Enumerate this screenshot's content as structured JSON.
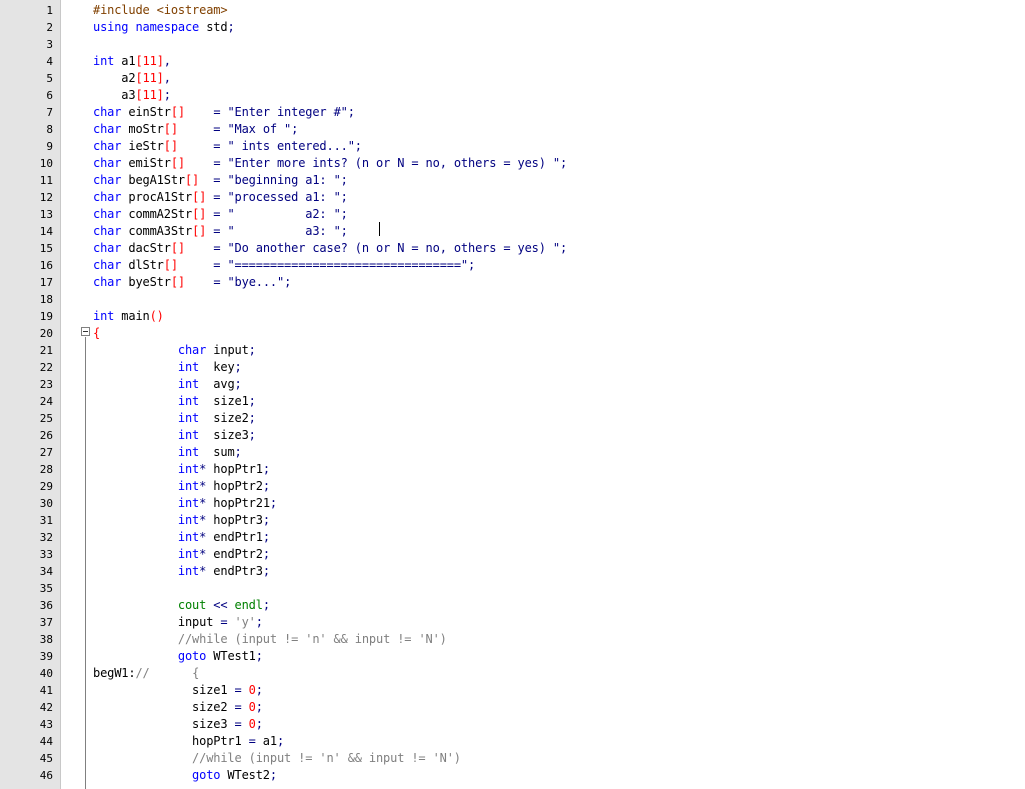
{
  "editor": {
    "lines": [
      {
        "n": "1",
        "tokens": [
          [
            "pp",
            "#include "
          ],
          [
            "pp",
            "<iostream>"
          ]
        ]
      },
      {
        "n": "2",
        "tokens": [
          [
            "kw",
            "using namespace"
          ],
          [
            "id",
            " std"
          ],
          [
            "op",
            ";"
          ]
        ]
      },
      {
        "n": "3",
        "tokens": []
      },
      {
        "n": "4",
        "tokens": [
          [
            "ty",
            "int"
          ],
          [
            "id",
            " a1"
          ],
          [
            "br",
            "[11]"
          ],
          [
            "op",
            ","
          ]
        ]
      },
      {
        "n": "5",
        "tokens": [
          [
            "id",
            "    a2"
          ],
          [
            "br",
            "[11]"
          ],
          [
            "op",
            ","
          ]
        ]
      },
      {
        "n": "6",
        "tokens": [
          [
            "id",
            "    a3"
          ],
          [
            "br",
            "[11]"
          ],
          [
            "op",
            ";"
          ]
        ]
      },
      {
        "n": "7",
        "tokens": [
          [
            "ty",
            "char"
          ],
          [
            "id",
            " einStr"
          ],
          [
            "br",
            "[]"
          ],
          [
            "id",
            "    "
          ],
          [
            "op",
            "="
          ],
          [
            "strb",
            " \"Enter integer #\""
          ],
          [
            "op",
            ";"
          ]
        ]
      },
      {
        "n": "8",
        "tokens": [
          [
            "ty",
            "char"
          ],
          [
            "id",
            " moStr"
          ],
          [
            "br",
            "[]"
          ],
          [
            "id",
            "     "
          ],
          [
            "op",
            "="
          ],
          [
            "strb",
            " \"Max of \""
          ],
          [
            "op",
            ";"
          ]
        ]
      },
      {
        "n": "9",
        "tokens": [
          [
            "ty",
            "char"
          ],
          [
            "id",
            " ieStr"
          ],
          [
            "br",
            "[]"
          ],
          [
            "id",
            "     "
          ],
          [
            "op",
            "="
          ],
          [
            "strb",
            " \" ints entered...\""
          ],
          [
            "op",
            ";"
          ]
        ]
      },
      {
        "n": "10",
        "tokens": [
          [
            "ty",
            "char"
          ],
          [
            "id",
            " emiStr"
          ],
          [
            "br",
            "[]"
          ],
          [
            "id",
            "    "
          ],
          [
            "op",
            "="
          ],
          [
            "strb",
            " \"Enter more ints? (n or N = no, others = yes) \""
          ],
          [
            "op",
            ";"
          ]
        ]
      },
      {
        "n": "11",
        "tokens": [
          [
            "ty",
            "char"
          ],
          [
            "id",
            " begA1Str"
          ],
          [
            "br",
            "[]"
          ],
          [
            "id",
            "  "
          ],
          [
            "op",
            "="
          ],
          [
            "strb",
            " \"beginning a1: \""
          ],
          [
            "op",
            ";"
          ]
        ]
      },
      {
        "n": "12",
        "tokens": [
          [
            "ty",
            "char"
          ],
          [
            "id",
            " procA1Str"
          ],
          [
            "br",
            "[]"
          ],
          [
            "id",
            " "
          ],
          [
            "op",
            "="
          ],
          [
            "strb",
            " \"processed a1: \""
          ],
          [
            "op",
            ";"
          ]
        ]
      },
      {
        "n": "13",
        "tokens": [
          [
            "ty",
            "char"
          ],
          [
            "id",
            " commA2Str"
          ],
          [
            "br",
            "[]"
          ],
          [
            "id",
            " "
          ],
          [
            "op",
            "="
          ],
          [
            "strb",
            " \"          a2: \""
          ],
          [
            "op",
            ";"
          ]
        ]
      },
      {
        "n": "14",
        "tokens": [
          [
            "ty",
            "char"
          ],
          [
            "id",
            " commA3Str"
          ],
          [
            "br",
            "[]"
          ],
          [
            "id",
            " "
          ],
          [
            "op",
            "="
          ],
          [
            "strb",
            " \"          a3: \""
          ],
          [
            "op",
            ";"
          ]
        ]
      },
      {
        "n": "15",
        "tokens": [
          [
            "ty",
            "char"
          ],
          [
            "id",
            " dacStr"
          ],
          [
            "br",
            "[]"
          ],
          [
            "id",
            "    "
          ],
          [
            "op",
            "="
          ],
          [
            "strb",
            " \"Do another case? (n or N = no, others = yes) \""
          ],
          [
            "op",
            ";"
          ]
        ]
      },
      {
        "n": "16",
        "tokens": [
          [
            "ty",
            "char"
          ],
          [
            "id",
            " dlStr"
          ],
          [
            "br",
            "[]"
          ],
          [
            "id",
            "     "
          ],
          [
            "op",
            "="
          ],
          [
            "strb",
            " \"================================\""
          ],
          [
            "op",
            ";"
          ]
        ]
      },
      {
        "n": "17",
        "tokens": [
          [
            "ty",
            "char"
          ],
          [
            "id",
            " byeStr"
          ],
          [
            "br",
            "[]"
          ],
          [
            "id",
            "    "
          ],
          [
            "op",
            "="
          ],
          [
            "strb",
            " \"bye...\""
          ],
          [
            "op",
            ";"
          ]
        ]
      },
      {
        "n": "18",
        "tokens": []
      },
      {
        "n": "19",
        "tokens": [
          [
            "ty",
            "int"
          ],
          [
            "id",
            " main"
          ],
          [
            "br",
            "()"
          ]
        ]
      },
      {
        "n": "20",
        "tokens": [
          [
            "br",
            "{"
          ]
        ]
      },
      {
        "n": "21",
        "tokens": [
          [
            "id",
            "            "
          ],
          [
            "ty",
            "char"
          ],
          [
            "id",
            " input"
          ],
          [
            "op",
            ";"
          ]
        ]
      },
      {
        "n": "22",
        "tokens": [
          [
            "id",
            "            "
          ],
          [
            "ty",
            "int"
          ],
          [
            "id",
            "  key"
          ],
          [
            "op",
            ";"
          ]
        ]
      },
      {
        "n": "23",
        "tokens": [
          [
            "id",
            "            "
          ],
          [
            "ty",
            "int"
          ],
          [
            "id",
            "  avg"
          ],
          [
            "op",
            ";"
          ]
        ]
      },
      {
        "n": "24",
        "tokens": [
          [
            "id",
            "            "
          ],
          [
            "ty",
            "int"
          ],
          [
            "id",
            "  size1"
          ],
          [
            "op",
            ";"
          ]
        ]
      },
      {
        "n": "25",
        "tokens": [
          [
            "id",
            "            "
          ],
          [
            "ty",
            "int"
          ],
          [
            "id",
            "  size2"
          ],
          [
            "op",
            ";"
          ]
        ]
      },
      {
        "n": "26",
        "tokens": [
          [
            "id",
            "            "
          ],
          [
            "ty",
            "int"
          ],
          [
            "id",
            "  size3"
          ],
          [
            "op",
            ";"
          ]
        ]
      },
      {
        "n": "27",
        "tokens": [
          [
            "id",
            "            "
          ],
          [
            "ty",
            "int"
          ],
          [
            "id",
            "  sum"
          ],
          [
            "op",
            ";"
          ]
        ]
      },
      {
        "n": "28",
        "tokens": [
          [
            "id",
            "            "
          ],
          [
            "ty",
            "int"
          ],
          [
            "op",
            "*"
          ],
          [
            "id",
            " hopPtr1"
          ],
          [
            "op",
            ";"
          ]
        ]
      },
      {
        "n": "29",
        "tokens": [
          [
            "id",
            "            "
          ],
          [
            "ty",
            "int"
          ],
          [
            "op",
            "*"
          ],
          [
            "id",
            " hopPtr2"
          ],
          [
            "op",
            ";"
          ]
        ]
      },
      {
        "n": "30",
        "tokens": [
          [
            "id",
            "            "
          ],
          [
            "ty",
            "int"
          ],
          [
            "op",
            "*"
          ],
          [
            "id",
            " hopPtr21"
          ],
          [
            "op",
            ";"
          ]
        ]
      },
      {
        "n": "31",
        "tokens": [
          [
            "id",
            "            "
          ],
          [
            "ty",
            "int"
          ],
          [
            "op",
            "*"
          ],
          [
            "id",
            " hopPtr3"
          ],
          [
            "op",
            ";"
          ]
        ]
      },
      {
        "n": "32",
        "tokens": [
          [
            "id",
            "            "
          ],
          [
            "ty",
            "int"
          ],
          [
            "op",
            "*"
          ],
          [
            "id",
            " endPtr1"
          ],
          [
            "op",
            ";"
          ]
        ]
      },
      {
        "n": "33",
        "tokens": [
          [
            "id",
            "            "
          ],
          [
            "ty",
            "int"
          ],
          [
            "op",
            "*"
          ],
          [
            "id",
            " endPtr2"
          ],
          [
            "op",
            ";"
          ]
        ]
      },
      {
        "n": "34",
        "tokens": [
          [
            "id",
            "            "
          ],
          [
            "ty",
            "int"
          ],
          [
            "op",
            "*"
          ],
          [
            "id",
            " endPtr3"
          ],
          [
            "op",
            ";"
          ]
        ]
      },
      {
        "n": "35",
        "tokens": []
      },
      {
        "n": "36",
        "tokens": [
          [
            "id",
            "            "
          ],
          [
            "cm",
            "cout"
          ],
          [
            "id",
            " "
          ],
          [
            "op",
            "<<"
          ],
          [
            "id",
            " "
          ],
          [
            "cm",
            "endl"
          ],
          [
            "op",
            ";"
          ]
        ]
      },
      {
        "n": "37",
        "tokens": [
          [
            "id",
            "            input "
          ],
          [
            "op",
            "="
          ],
          [
            "id",
            " "
          ],
          [
            "str",
            "'y'"
          ],
          [
            "op",
            ";"
          ]
        ]
      },
      {
        "n": "38",
        "tokens": [
          [
            "id",
            "            "
          ],
          [
            "str",
            "//while (input != 'n' && input != 'N')"
          ]
        ]
      },
      {
        "n": "39",
        "tokens": [
          [
            "id",
            "            "
          ],
          [
            "kw",
            "goto"
          ],
          [
            "id",
            " WTest1"
          ],
          [
            "op",
            ";"
          ]
        ]
      },
      {
        "n": "40",
        "tokens": [
          [
            "id",
            "begW1:"
          ],
          [
            "str",
            "//"
          ],
          [
            "id",
            "      "
          ],
          [
            "str",
            "{"
          ]
        ]
      },
      {
        "n": "41",
        "tokens": [
          [
            "id",
            "              size1 "
          ],
          [
            "op",
            "="
          ],
          [
            "id",
            " "
          ],
          [
            "num",
            "0"
          ],
          [
            "op",
            ";"
          ]
        ]
      },
      {
        "n": "42",
        "tokens": [
          [
            "id",
            "              size2 "
          ],
          [
            "op",
            "="
          ],
          [
            "id",
            " "
          ],
          [
            "num",
            "0"
          ],
          [
            "op",
            ";"
          ]
        ]
      },
      {
        "n": "43",
        "tokens": [
          [
            "id",
            "              size3 "
          ],
          [
            "op",
            "="
          ],
          [
            "id",
            " "
          ],
          [
            "num",
            "0"
          ],
          [
            "op",
            ";"
          ]
        ]
      },
      {
        "n": "44",
        "tokens": [
          [
            "id",
            "              hopPtr1 "
          ],
          [
            "op",
            "="
          ],
          [
            "id",
            " a1"
          ],
          [
            "op",
            ";"
          ]
        ]
      },
      {
        "n": "45",
        "tokens": [
          [
            "id",
            "              "
          ],
          [
            "str",
            "//while (input != 'n' && input != 'N')"
          ]
        ]
      },
      {
        "n": "46",
        "tokens": [
          [
            "id",
            "              "
          ],
          [
            "kw",
            "goto"
          ],
          [
            "id",
            " WTest2"
          ],
          [
            "op",
            ";"
          ]
        ]
      }
    ]
  }
}
